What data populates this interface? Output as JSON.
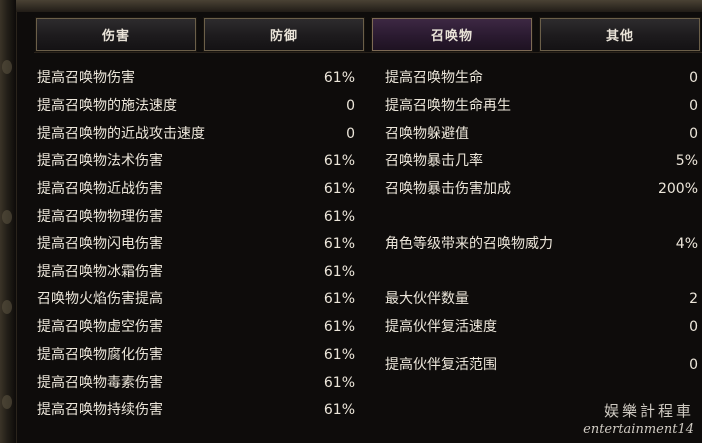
{
  "tabs": [
    {
      "label": "伤害",
      "active": false
    },
    {
      "label": "防御",
      "active": false
    },
    {
      "label": "召唤物",
      "active": true
    },
    {
      "label": "其他",
      "active": false
    }
  ],
  "left_stats": [
    {
      "label": "提高召唤物伤害",
      "value": "61%"
    },
    {
      "label": "提高召唤物的施法速度",
      "value": "0"
    },
    {
      "label": "提高召唤物的近战攻击速度",
      "value": "0"
    },
    {
      "label": "提高召唤物法术伤害",
      "value": "61%"
    },
    {
      "label": "提高召唤物近战伤害",
      "value": "61%"
    },
    {
      "label": "提高召唤物物理伤害",
      "value": "61%"
    },
    {
      "label": "提高召唤物闪电伤害",
      "value": "61%"
    },
    {
      "label": "提高召唤物冰霜伤害",
      "value": "61%"
    },
    {
      "label": "召唤物火焰伤害提高",
      "value": "61%"
    },
    {
      "label": "提高召唤物虚空伤害",
      "value": "61%"
    },
    {
      "label": "提高召唤物腐化伤害",
      "value": "61%"
    },
    {
      "label": "提高召唤物毒素伤害",
      "value": "61%"
    },
    {
      "label": "提高召唤物持续伤害",
      "value": "61%"
    }
  ],
  "right_stats": [
    {
      "label": "提高召唤物生命",
      "value": "0"
    },
    {
      "label": "提高召唤物生命再生",
      "value": "0"
    },
    {
      "label": "召唤物躲避值",
      "value": "0"
    },
    {
      "label": "召唤物暴击几率",
      "value": "5%"
    },
    {
      "label": "召唤物暴击伤害加成",
      "value": "200%"
    },
    {
      "label": "角色等级带来的召唤物威力",
      "value": "4%"
    },
    {
      "label": "最大伙伴数量",
      "value": "2"
    },
    {
      "label": "提高伙伴复活速度",
      "value": "0"
    },
    {
      "label": "提高伙伴复活范围",
      "value": "0"
    }
  ],
  "watermark": {
    "cn": "娱樂計程車",
    "en": "entertainment14"
  },
  "colors": {
    "background": "#0e0c0b",
    "text": "#ece6da",
    "tab_active": "#2a1a30",
    "tab_border": "#6b5f49"
  }
}
